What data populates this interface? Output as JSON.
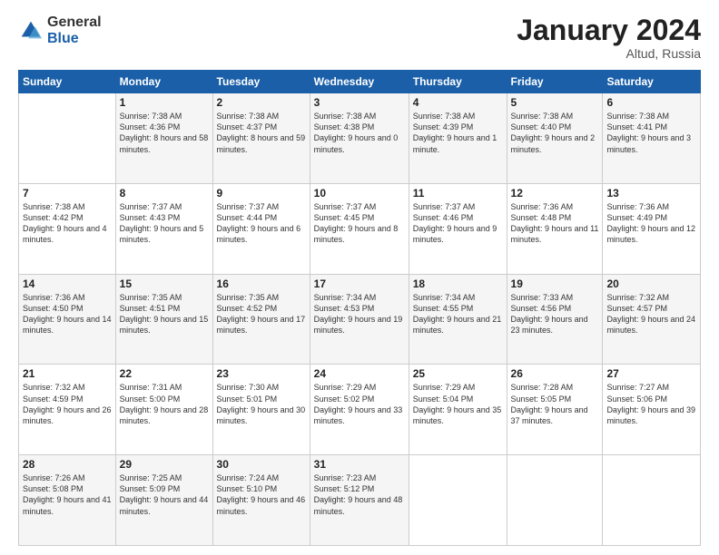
{
  "logo": {
    "general": "General",
    "blue": "Blue"
  },
  "header": {
    "month": "January 2024",
    "location": "Altud, Russia"
  },
  "weekdays": [
    "Sunday",
    "Monday",
    "Tuesday",
    "Wednesday",
    "Thursday",
    "Friday",
    "Saturday"
  ],
  "weeks": [
    [
      {
        "day": "",
        "sunrise": "",
        "sunset": "",
        "daylight": ""
      },
      {
        "day": "1",
        "sunrise": "Sunrise: 7:38 AM",
        "sunset": "Sunset: 4:36 PM",
        "daylight": "Daylight: 8 hours and 58 minutes."
      },
      {
        "day": "2",
        "sunrise": "Sunrise: 7:38 AM",
        "sunset": "Sunset: 4:37 PM",
        "daylight": "Daylight: 8 hours and 59 minutes."
      },
      {
        "day": "3",
        "sunrise": "Sunrise: 7:38 AM",
        "sunset": "Sunset: 4:38 PM",
        "daylight": "Daylight: 9 hours and 0 minutes."
      },
      {
        "day": "4",
        "sunrise": "Sunrise: 7:38 AM",
        "sunset": "Sunset: 4:39 PM",
        "daylight": "Daylight: 9 hours and 1 minute."
      },
      {
        "day": "5",
        "sunrise": "Sunrise: 7:38 AM",
        "sunset": "Sunset: 4:40 PM",
        "daylight": "Daylight: 9 hours and 2 minutes."
      },
      {
        "day": "6",
        "sunrise": "Sunrise: 7:38 AM",
        "sunset": "Sunset: 4:41 PM",
        "daylight": "Daylight: 9 hours and 3 minutes."
      }
    ],
    [
      {
        "day": "7",
        "sunrise": "Sunrise: 7:38 AM",
        "sunset": "Sunset: 4:42 PM",
        "daylight": "Daylight: 9 hours and 4 minutes."
      },
      {
        "day": "8",
        "sunrise": "Sunrise: 7:37 AM",
        "sunset": "Sunset: 4:43 PM",
        "daylight": "Daylight: 9 hours and 5 minutes."
      },
      {
        "day": "9",
        "sunrise": "Sunrise: 7:37 AM",
        "sunset": "Sunset: 4:44 PM",
        "daylight": "Daylight: 9 hours and 6 minutes."
      },
      {
        "day": "10",
        "sunrise": "Sunrise: 7:37 AM",
        "sunset": "Sunset: 4:45 PM",
        "daylight": "Daylight: 9 hours and 8 minutes."
      },
      {
        "day": "11",
        "sunrise": "Sunrise: 7:37 AM",
        "sunset": "Sunset: 4:46 PM",
        "daylight": "Daylight: 9 hours and 9 minutes."
      },
      {
        "day": "12",
        "sunrise": "Sunrise: 7:36 AM",
        "sunset": "Sunset: 4:48 PM",
        "daylight": "Daylight: 9 hours and 11 minutes."
      },
      {
        "day": "13",
        "sunrise": "Sunrise: 7:36 AM",
        "sunset": "Sunset: 4:49 PM",
        "daylight": "Daylight: 9 hours and 12 minutes."
      }
    ],
    [
      {
        "day": "14",
        "sunrise": "Sunrise: 7:36 AM",
        "sunset": "Sunset: 4:50 PM",
        "daylight": "Daylight: 9 hours and 14 minutes."
      },
      {
        "day": "15",
        "sunrise": "Sunrise: 7:35 AM",
        "sunset": "Sunset: 4:51 PM",
        "daylight": "Daylight: 9 hours and 15 minutes."
      },
      {
        "day": "16",
        "sunrise": "Sunrise: 7:35 AM",
        "sunset": "Sunset: 4:52 PM",
        "daylight": "Daylight: 9 hours and 17 minutes."
      },
      {
        "day": "17",
        "sunrise": "Sunrise: 7:34 AM",
        "sunset": "Sunset: 4:53 PM",
        "daylight": "Daylight: 9 hours and 19 minutes."
      },
      {
        "day": "18",
        "sunrise": "Sunrise: 7:34 AM",
        "sunset": "Sunset: 4:55 PM",
        "daylight": "Daylight: 9 hours and 21 minutes."
      },
      {
        "day": "19",
        "sunrise": "Sunrise: 7:33 AM",
        "sunset": "Sunset: 4:56 PM",
        "daylight": "Daylight: 9 hours and 23 minutes."
      },
      {
        "day": "20",
        "sunrise": "Sunrise: 7:32 AM",
        "sunset": "Sunset: 4:57 PM",
        "daylight": "Daylight: 9 hours and 24 minutes."
      }
    ],
    [
      {
        "day": "21",
        "sunrise": "Sunrise: 7:32 AM",
        "sunset": "Sunset: 4:59 PM",
        "daylight": "Daylight: 9 hours and 26 minutes."
      },
      {
        "day": "22",
        "sunrise": "Sunrise: 7:31 AM",
        "sunset": "Sunset: 5:00 PM",
        "daylight": "Daylight: 9 hours and 28 minutes."
      },
      {
        "day": "23",
        "sunrise": "Sunrise: 7:30 AM",
        "sunset": "Sunset: 5:01 PM",
        "daylight": "Daylight: 9 hours and 30 minutes."
      },
      {
        "day": "24",
        "sunrise": "Sunrise: 7:29 AM",
        "sunset": "Sunset: 5:02 PM",
        "daylight": "Daylight: 9 hours and 33 minutes."
      },
      {
        "day": "25",
        "sunrise": "Sunrise: 7:29 AM",
        "sunset": "Sunset: 5:04 PM",
        "daylight": "Daylight: 9 hours and 35 minutes."
      },
      {
        "day": "26",
        "sunrise": "Sunrise: 7:28 AM",
        "sunset": "Sunset: 5:05 PM",
        "daylight": "Daylight: 9 hours and 37 minutes."
      },
      {
        "day": "27",
        "sunrise": "Sunrise: 7:27 AM",
        "sunset": "Sunset: 5:06 PM",
        "daylight": "Daylight: 9 hours and 39 minutes."
      }
    ],
    [
      {
        "day": "28",
        "sunrise": "Sunrise: 7:26 AM",
        "sunset": "Sunset: 5:08 PM",
        "daylight": "Daylight: 9 hours and 41 minutes."
      },
      {
        "day": "29",
        "sunrise": "Sunrise: 7:25 AM",
        "sunset": "Sunset: 5:09 PM",
        "daylight": "Daylight: 9 hours and 44 minutes."
      },
      {
        "day": "30",
        "sunrise": "Sunrise: 7:24 AM",
        "sunset": "Sunset: 5:10 PM",
        "daylight": "Daylight: 9 hours and 46 minutes."
      },
      {
        "day": "31",
        "sunrise": "Sunrise: 7:23 AM",
        "sunset": "Sunset: 5:12 PM",
        "daylight": "Daylight: 9 hours and 48 minutes."
      },
      {
        "day": "",
        "sunrise": "",
        "sunset": "",
        "daylight": ""
      },
      {
        "day": "",
        "sunrise": "",
        "sunset": "",
        "daylight": ""
      },
      {
        "day": "",
        "sunrise": "",
        "sunset": "",
        "daylight": ""
      }
    ]
  ]
}
